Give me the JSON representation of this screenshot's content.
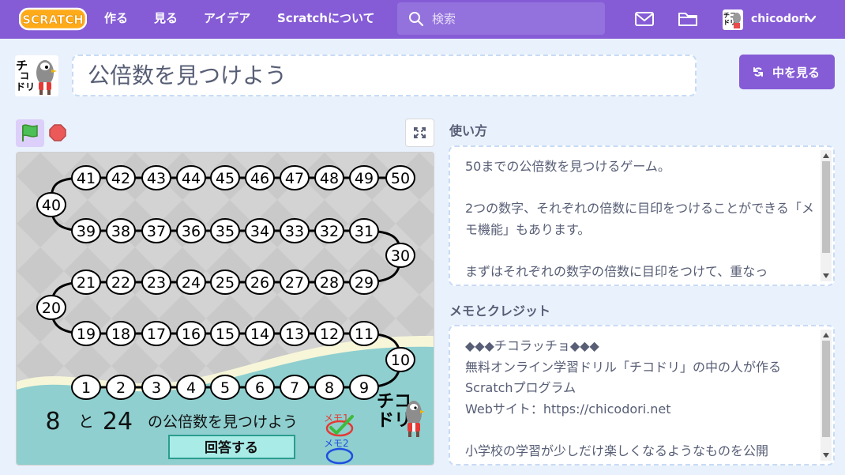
{
  "nav": {
    "logo_text": "SCRATCH",
    "links": [
      "作る",
      "見る",
      "アイデア",
      "Scratchについて"
    ],
    "search_placeholder": "検索",
    "username": "chicodori"
  },
  "project": {
    "title": "公倍数を見つけよう",
    "see_inside_label": "中を見る"
  },
  "game": {
    "number_a": "8",
    "number_b": "24",
    "connector": "と",
    "prompt": "の公倍数を見つけよう",
    "answer_button": "回答する",
    "memo1_label": "メモ1",
    "memo2_label": "メモ2",
    "logo_line1": "チコ",
    "logo_line2": "ドリ",
    "circles": [
      "1",
      "2",
      "3",
      "4",
      "5",
      "6",
      "7",
      "8",
      "9",
      "10",
      "11",
      "12",
      "13",
      "14",
      "15",
      "16",
      "17",
      "18",
      "19",
      "20",
      "21",
      "22",
      "23",
      "24",
      "25",
      "26",
      "27",
      "28",
      "29",
      "30",
      "31",
      "32",
      "33",
      "34",
      "35",
      "36",
      "37",
      "38",
      "39",
      "40",
      "41",
      "42",
      "43",
      "44",
      "45",
      "46",
      "47",
      "48",
      "49",
      "50"
    ]
  },
  "instructions": {
    "heading": "使い方",
    "text": "50までの公倍数を見つけるゲーム。\n\n2つの数字、それぞれの倍数に目印をつけることができる「メモ機能」もあります。\n\nまずはそれぞれの数字の倍数に目印をつけて、重なっ"
  },
  "credits": {
    "heading": "メモとクレジット",
    "text": "◆◆◆チコラッチョ◆◆◆\n無料オンライン学習ドリル「チコドリ」の中の人が作るScratchプログラム\nWebサイト：https://chicodori.net\n\n小学校の学習が少しだけ楽しくなるようなものを公開"
  },
  "colors": {
    "nav": "#855cd6",
    "page_bg": "#e9f1fc",
    "text": "#575e75",
    "stage_bg": "#d5d5d5",
    "teal": "#8fcfcf",
    "cream": "#f7f6d9",
    "button_teal": "#a9ebe6"
  }
}
